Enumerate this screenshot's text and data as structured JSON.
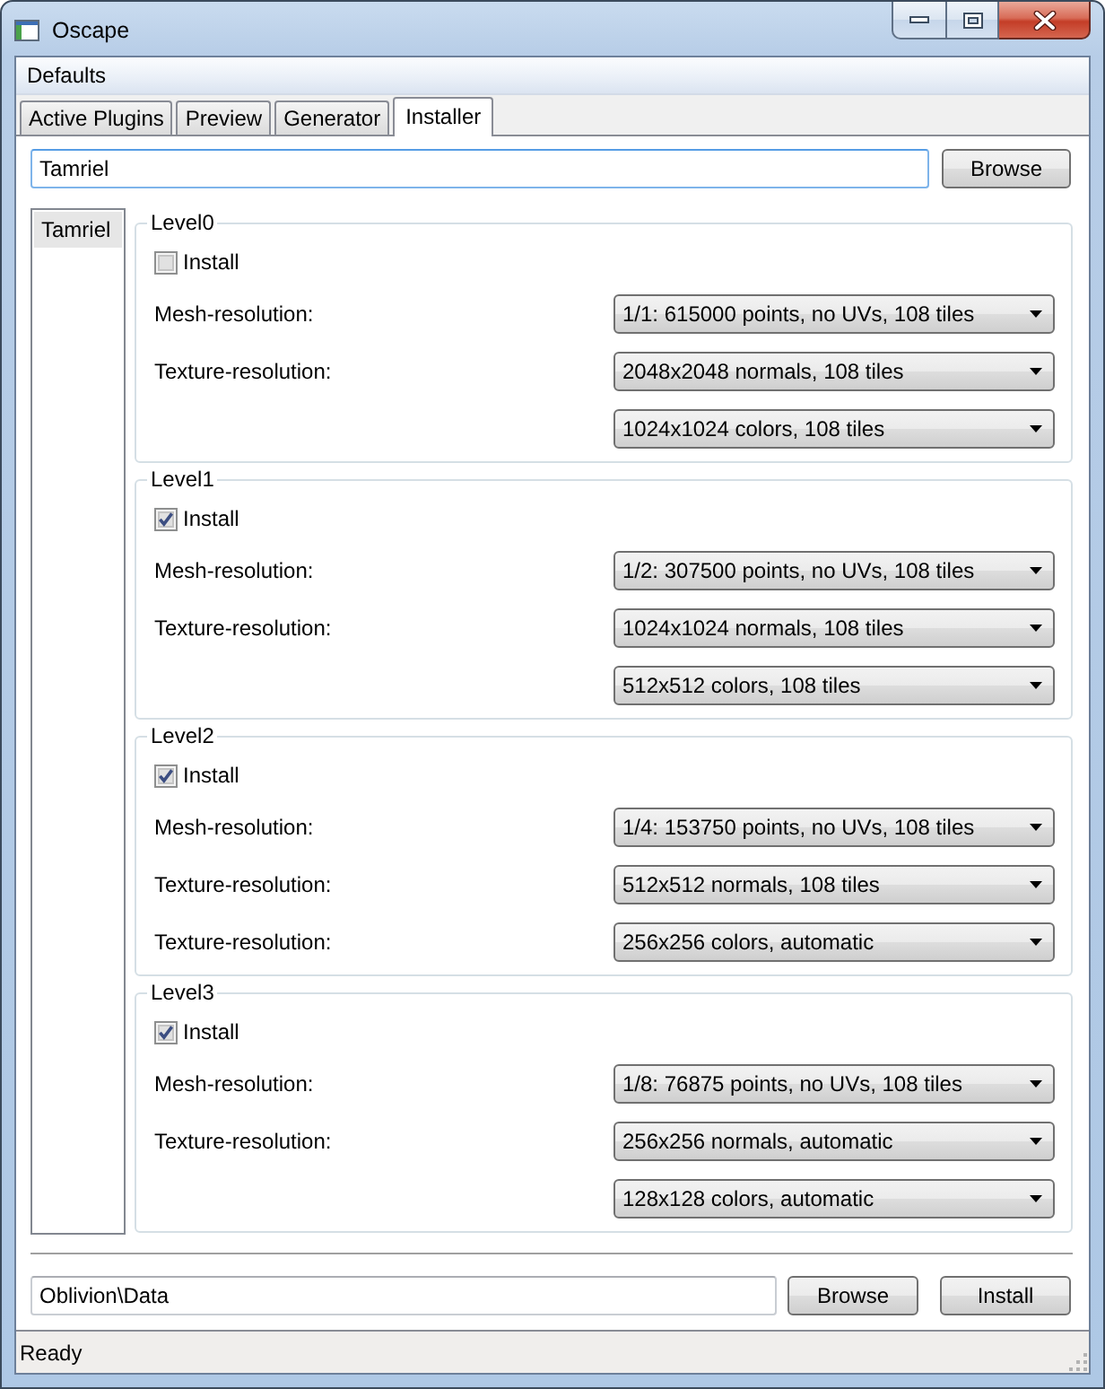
{
  "window": {
    "title": "Oscape"
  },
  "menu": [
    {
      "label": "Defaults"
    }
  ],
  "tabs": [
    {
      "label": "Active Plugins",
      "selected": false
    },
    {
      "label": "Preview",
      "selected": false
    },
    {
      "label": "Generator",
      "selected": false
    },
    {
      "label": "Installer",
      "selected": true
    }
  ],
  "worldspace_path": {
    "value": "Tamriel",
    "focused": true
  },
  "browse_button": "Browse",
  "worldspaces": [
    {
      "label": "Tamriel",
      "selected": true
    }
  ],
  "levels": [
    {
      "title": "Level0",
      "install": {
        "label": "Install",
        "checked": false
      },
      "rows": [
        {
          "label": "Mesh-resolution:",
          "value": "1/1: 615000 points, no UVs, 108 tiles"
        },
        {
          "label": "Texture-resolution:",
          "value": "2048x2048 normals, 108 tiles"
        },
        {
          "value": "1024x1024 colors, 108 tiles"
        }
      ]
    },
    {
      "title": "Level1",
      "install": {
        "label": "Install",
        "checked": true
      },
      "rows": [
        {
          "label": "Mesh-resolution:",
          "value": "1/2: 307500 points, no UVs, 108 tiles"
        },
        {
          "label": "Texture-resolution:",
          "value": "1024x1024 normals, 108 tiles"
        },
        {
          "value": "512x512 colors, 108 tiles"
        }
      ]
    },
    {
      "title": "Level2",
      "install": {
        "label": "Install",
        "checked": true
      },
      "rows": [
        {
          "label": "Mesh-resolution:",
          "value": "1/4: 153750 points, no UVs, 108 tiles"
        },
        {
          "label": "Texture-resolution:",
          "value": "512x512 normals, 108 tiles"
        },
        {
          "label": "Texture-resolution:",
          "value": "256x256 colors, automatic"
        }
      ]
    },
    {
      "title": "Level3",
      "install": {
        "label": "Install",
        "checked": true
      },
      "rows": [
        {
          "label": "Mesh-resolution:",
          "value": "1/8: 76875 points, no UVs, 108 tiles"
        },
        {
          "label": "Texture-resolution:",
          "value": "256x256 normals, automatic"
        },
        {
          "value": "128x128 colors, automatic"
        }
      ]
    }
  ],
  "output_path": {
    "value": "Oblivion\\Data",
    "focused": false
  },
  "buttons": [
    "Browse",
    "Install"
  ],
  "status_bar": "Ready"
}
